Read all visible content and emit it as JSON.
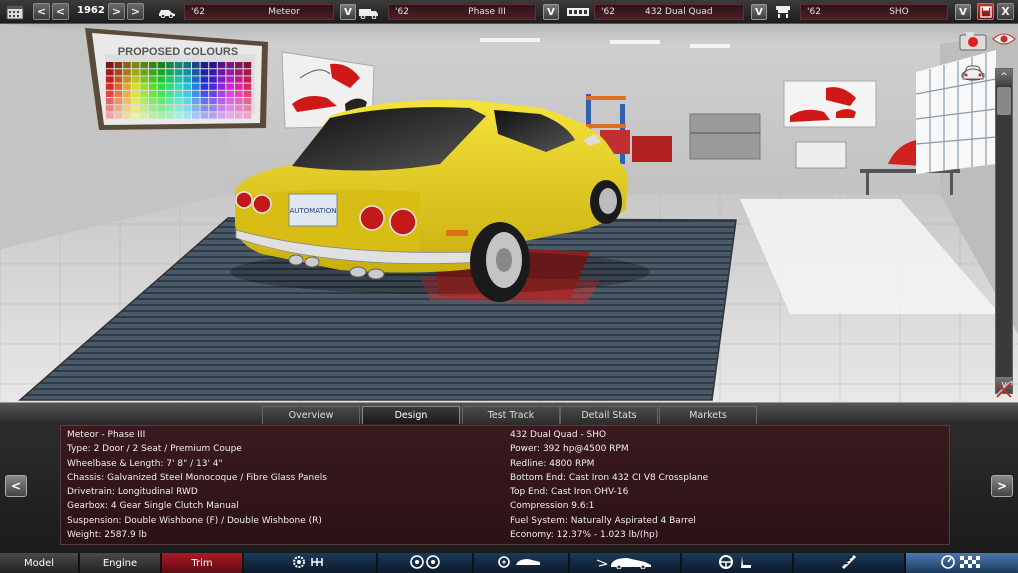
{
  "topbar": {
    "year": "1962",
    "prev_label": "<",
    "next_label": ">",
    "selectors": [
      {
        "icon": "car-icon",
        "year": "'62",
        "name": "Meteor"
      },
      {
        "icon": "trim-icon",
        "year": "'62",
        "name": "Phase III"
      },
      {
        "icon": "engine-icon",
        "year": "'62",
        "name": "432  Dual Quad"
      },
      {
        "icon": "engine-top-icon",
        "year": "'62",
        "name": "SHO"
      }
    ],
    "dropdown_label": "V",
    "save_icon": "save-icon",
    "close_label": "X"
  },
  "scene": {
    "poster_title": "PROPOSED COLOURS",
    "plate_text": "AUTOMATION",
    "car_color": "#e8d01a"
  },
  "scene_controls": {
    "icons": [
      "camera-icon",
      "eye-icon",
      "view-front-icon",
      "view-top-icon",
      "view-side-icon",
      "view-rear-icon",
      "wrench-cross-icon"
    ],
    "scroll_up": "^",
    "scroll_down": "v"
  },
  "tabs": [
    {
      "label": "Overview",
      "active": false
    },
    {
      "label": "Design",
      "active": true
    },
    {
      "label": "Test Track",
      "active": false
    },
    {
      "label": "Detail Stats",
      "active": false
    },
    {
      "label": "Markets",
      "active": false
    }
  ],
  "info": {
    "left": [
      "Meteor - Phase III",
      "Type: 2 Door / 2 Seat / Premium Coupe",
      "Wheelbase & Length: 7' 8\" / 13' 4\"",
      "Chassis: Galvanized Steel Monocoque / Fibre Glass Panels",
      "Drivetrain: Longitudinal RWD",
      "Gearbox: 4 Gear Single Clutch Manual",
      "Suspension: Double Wishbone (F) / Double Wishbone (R)",
      "Weight: 2587.9 lb"
    ],
    "right": [
      "432  Dual Quad - SHO",
      "Power: 392 hp@4500 RPM",
      "Redline: 4800 RPM",
      "Bottom End: Cast Iron 432 CI V8 Crossplane",
      "Top End: Cast Iron OHV-16",
      "Compression 9.6:1",
      "Fuel System: Naturally Aspirated 4 Barrel",
      "Economy: 12.37% - 1.023 lb/(hp)"
    ],
    "prev_label": "<",
    "next_label": ">"
  },
  "bottomnav": {
    "model": "Model",
    "engine": "Engine",
    "trim": "Trim",
    "icons": [
      "engine-gear-icon",
      "wheels-icon",
      "body-fixtures-icon",
      "aero-icon",
      "interior-icon",
      "suspension-icon",
      "test-icon"
    ]
  },
  "colors": {
    "accent_red": "#8a1020",
    "car_yellow": "#e8d01a",
    "panel_bg": "#2b1216"
  }
}
